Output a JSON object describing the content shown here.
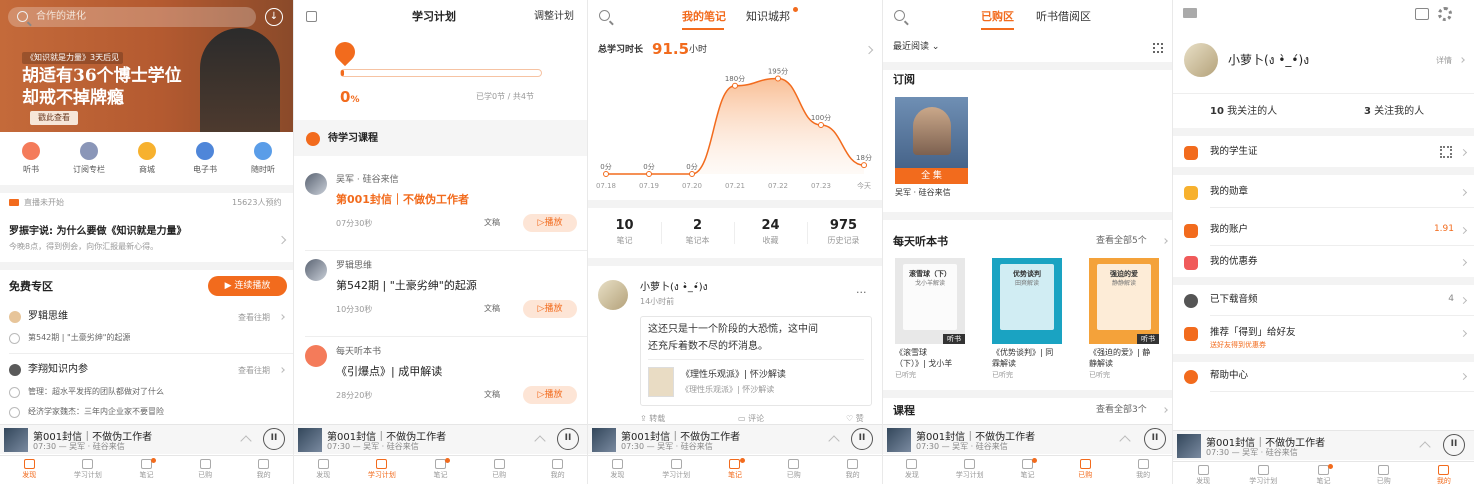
{
  "player": {
    "title": "第001封信｜不做伪工作者",
    "sub": "07:30 — 吴军 · 硅谷来信",
    "sub5": "07:30 — 吴军 · 硅谷来信"
  },
  "tabs": [
    "发现",
    "学习计划",
    "笔记",
    "已购",
    "我的"
  ],
  "s1": {
    "search_placeholder": "合作的进化",
    "banner": {
      "tag": "《知识就是力量》3天后见",
      "line1": "胡适有36个博士学位",
      "line2": "却戒不掉牌瘾",
      "btn": "戳此查看"
    },
    "cats": [
      {
        "label": "听书",
        "color": "#f47b5a"
      },
      {
        "label": "订阅专栏",
        "color": "#8a96b8"
      },
      {
        "label": "商城",
        "color": "#f7b12e"
      },
      {
        "label": "电子书",
        "color": "#4f86d9"
      },
      {
        "label": "随时听",
        "color": "#5a9de8"
      }
    ],
    "live": {
      "status": "直播未开始",
      "count": "15623人预约",
      "title": "罗振宇说: 为什么要做《知识就是力量》",
      "desc": "今晚8点，得到例会，向你汇报最新心得。"
    },
    "free": {
      "title": "免费专区",
      "btn": "连续播放",
      "more": "查看往期"
    },
    "items": [
      {
        "author": "罗辑思维",
        "more": "查看往期",
        "ep": "第542期 | \"土豪劣绅\"的起源"
      },
      {
        "author": "李翔知识内参",
        "more": "查看往期",
        "ep1": "管理：超水平发挥的团队都做对了什么",
        "ep2": "经济学家魏杰：三年内企业家不要冒险"
      }
    ]
  },
  "s2": {
    "title": "学习计划",
    "adjust": "调整计划",
    "pct": "0",
    "pct_unit": "%",
    "learned": "已学0节 / 共4节",
    "progress": 0,
    "section": "待学习课程",
    "courses": [
      {
        "author": "吴军 · 硅谷来信",
        "title": "第001封信｜不做伪工作者",
        "dur": "07分30秒",
        "doc": "文稿",
        "play": "播放",
        "active": true
      },
      {
        "author": "罗辑思维",
        "title": "第542期 | \"土豪劣绅\"的起源",
        "dur": "10分30秒",
        "doc": "文稿",
        "play": "播放",
        "active": false
      },
      {
        "author": "每天听本书",
        "title": "《引爆点》| 成甲解读",
        "dur": "28分20秒",
        "doc": "文稿",
        "play": "播放",
        "active": false
      }
    ]
  },
  "s3": {
    "tabs": [
      "我的笔记",
      "知识城邦"
    ],
    "total_label": "总学习时长",
    "total_value": "91.5",
    "total_unit": "小时",
    "stats": [
      {
        "v": "10",
        "l": "笔记"
      },
      {
        "v": "2",
        "l": "笔记本"
      },
      {
        "v": "24",
        "l": "收藏"
      },
      {
        "v": "975",
        "l": "历史记录"
      }
    ],
    "note": {
      "user": "小萝卜(ง •̀_•́)ง",
      "time": "14小时前",
      "more": "···",
      "text1": "这还只是十一个阶段的大恐慌，这中间",
      "text2": "还充斥着数不尽的坏消息。",
      "book": "《理性乐观派》| 怀沙解读",
      "book2": "《理性乐观派》| 怀沙解读",
      "act1": "转载",
      "act2": "评论",
      "act3": "赞"
    }
  },
  "chart_data": {
    "type": "area",
    "x": [
      "07.18",
      "07.19",
      "07.20",
      "07.21",
      "07.22",
      "07.23",
      "今天"
    ],
    "values": [
      0,
      0,
      0,
      180,
      195,
      100,
      18
    ],
    "labels": [
      "0分",
      "0分",
      "0分",
      "180分",
      "195分",
      "100分",
      "18分"
    ],
    "ylim": [
      0,
      200
    ],
    "color": "#f26b1d"
  },
  "s4": {
    "tabs": [
      "已购区",
      "听书借阅区"
    ],
    "sort": "最近阅读",
    "sub_title": "订阅",
    "sub_badge": "全 集",
    "sub_name": "吴军 · 硅谷来信",
    "daily_title": "每天听本书",
    "daily_more": "查看全部5个",
    "books": [
      {
        "cover": "滚雪球（下）",
        "cover_sub": "戈小羊解读",
        "title1": "《滚雪球",
        "title2": "（下）》| 戈小羊",
        "status": "已听完",
        "badge": "听书",
        "bg": "#e8e8e8"
      },
      {
        "cover": "优势谈判",
        "cover_sub": "田爽解读",
        "title1": "《优势谈判》| 同",
        "title2": "霖解读",
        "status": "已听完",
        "badge": "",
        "bg": "#1aa3c2"
      },
      {
        "cover": "强迫的爱",
        "cover_sub": "静静解读",
        "title1": "《强迫的爱》| 静",
        "title2": "静解读",
        "status": "已听完",
        "badge": "听书",
        "bg": "#f4a23a"
      }
    ],
    "course_title": "课程",
    "course_more": "查看全部3个"
  },
  "s5": {
    "name": "小萝卜(ง •̀_•́)ง",
    "detail": "详情",
    "following_n": "10",
    "following_l": "我关注的人",
    "followers_n": "3",
    "followers_l": "关注我的人",
    "rows": [
      {
        "label": "我的学生证",
        "color": "#f26b1d",
        "icon": "id-card-icon",
        "val": ""
      },
      {
        "label": "我的勋章",
        "color": "#f7b12e",
        "icon": "medal-icon",
        "val": ""
      },
      {
        "label": "我的账户",
        "color": "#f26b1d",
        "icon": "wallet-icon",
        "val": "1.91"
      },
      {
        "label": "我的优惠券",
        "color": "#f05a5a",
        "icon": "coupon-icon",
        "val": ""
      },
      {
        "label": "已下载音频",
        "color": "#555555",
        "icon": "download-icon",
        "val": "4"
      },
      {
        "label": "推荐「得到」给好友",
        "color": "#f26b1d",
        "icon": "share-icon",
        "val": "",
        "sub": "送好友得到优惠券"
      },
      {
        "label": "帮助中心",
        "color": "#f26b1d",
        "icon": "help-icon",
        "val": ""
      }
    ]
  }
}
